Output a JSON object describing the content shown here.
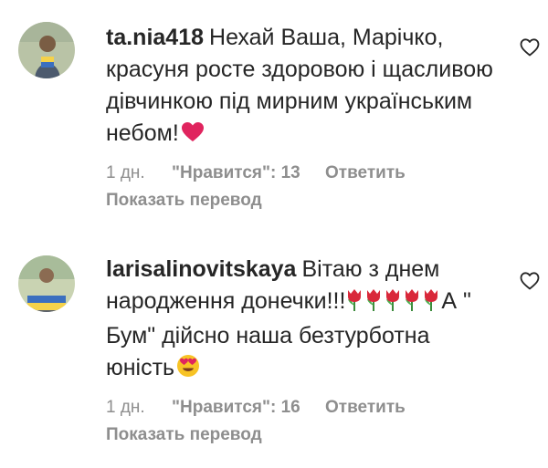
{
  "comments": [
    {
      "username": "ta.nia418",
      "text": "Нехай Ваша, Марічко, красуня росте здоровою і щасливою дівчинкою під мирним українським небом!",
      "emoji": "heart-emoji",
      "time": "1 дн.",
      "likes": "\"Нравится\": 13",
      "reply": "Ответить",
      "translate": "Показать перевод",
      "like_icon": "heart-outline-icon"
    },
    {
      "username": "larisalinovitskaya",
      "text_before_emoji": "Вітаю з днем народження донечки!!!",
      "emoji": "tulip-emoji x5",
      "text_after_emoji": "А \" Бум\" дійсно наша безтурботна юність",
      "trailing_emoji": "heart-eyes-emoji",
      "time": "1 дн.",
      "likes": "\"Нравится\": 16",
      "reply": "Ответить",
      "translate": "Показать перевод",
      "like_icon": "heart-outline-icon"
    }
  ],
  "colors": {
    "text": "#262626",
    "secondary": "#8e8e8e",
    "heart": "#e0245e"
  }
}
